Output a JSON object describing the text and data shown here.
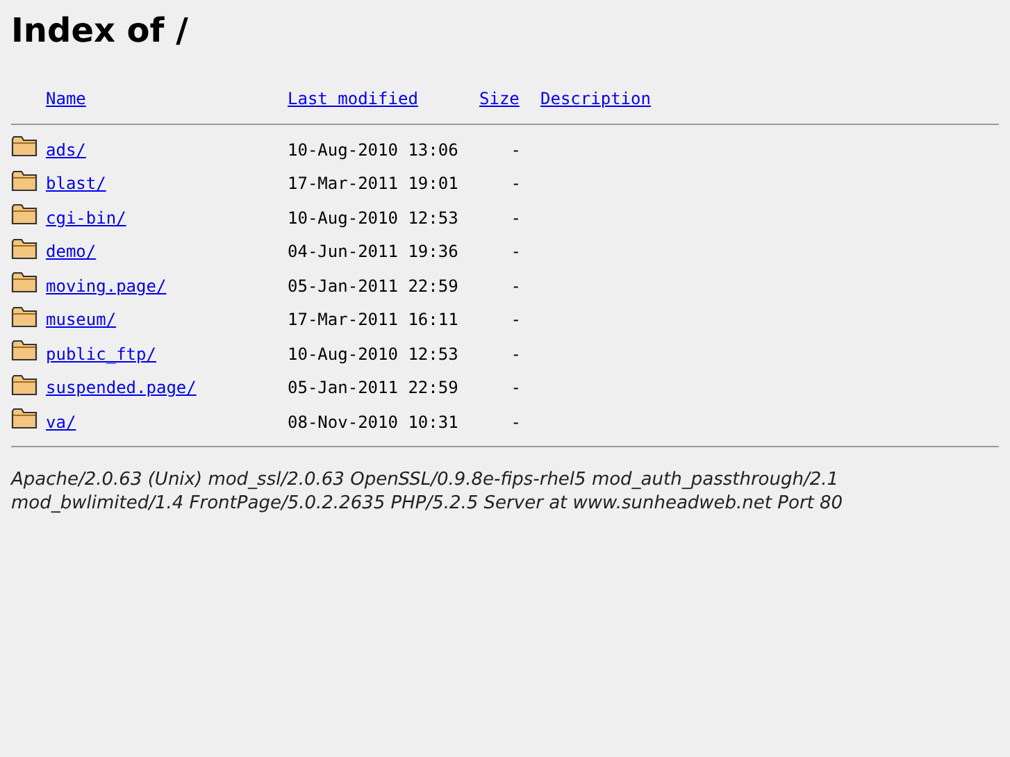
{
  "title": "Index of /",
  "columns": [
    "Name",
    "Last modified",
    "Size",
    "Description"
  ],
  "rows": [
    {
      "name": "ads/",
      "modified": "10-Aug-2010 13:06",
      "size": "-"
    },
    {
      "name": "blast/",
      "modified": "17-Mar-2011 19:01",
      "size": "-"
    },
    {
      "name": "cgi-bin/",
      "modified": "10-Aug-2010 12:53",
      "size": "-"
    },
    {
      "name": "demo/",
      "modified": "04-Jun-2011 19:36",
      "size": "-"
    },
    {
      "name": "moving.page/",
      "modified": "05-Jan-2011 22:59",
      "size": "-"
    },
    {
      "name": "museum/",
      "modified": "17-Mar-2011 16:11",
      "size": "-"
    },
    {
      "name": "public_ftp/",
      "modified": "10-Aug-2010 12:53",
      "size": "-"
    },
    {
      "name": "suspended.page/",
      "modified": "05-Jan-2011 22:59",
      "size": "-"
    },
    {
      "name": "va/",
      "modified": "08-Nov-2010 10:31",
      "size": "-"
    }
  ],
  "footer": "Apache/2.0.63 (Unix) mod_ssl/2.0.63 OpenSSL/0.9.8e-fips-rhel5 mod_auth_passthrough/2.1 mod_bwlimited/1.4 FrontPage/5.0.2.2635 PHP/5.2.5 Server at www.sunheadweb.net Port 80"
}
